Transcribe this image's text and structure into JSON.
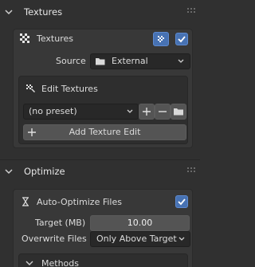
{
  "textures_panel": {
    "title": "Textures",
    "icon": "chevron-down-icon",
    "header_checkbox_checked": true,
    "header_label": "Textures",
    "source_label": "Source",
    "source_value": "External",
    "edit_textures": {
      "title": "Edit Textures",
      "preset_value": "(no preset)",
      "add_button_label": "Add Texture Edit"
    }
  },
  "optimize_panel": {
    "title": "Optimize",
    "auto_optimize_label": "Auto-Optimize Files",
    "auto_optimize_checked": true,
    "target_label": "Target (MB)",
    "target_value": "10.00",
    "overwrite_label": "Overwrite Files",
    "overwrite_value": "Only Above Target",
    "methods_label": "Methods"
  },
  "colors": {
    "background": "#303030",
    "panel": "#383838",
    "accent": "#4772b3"
  }
}
